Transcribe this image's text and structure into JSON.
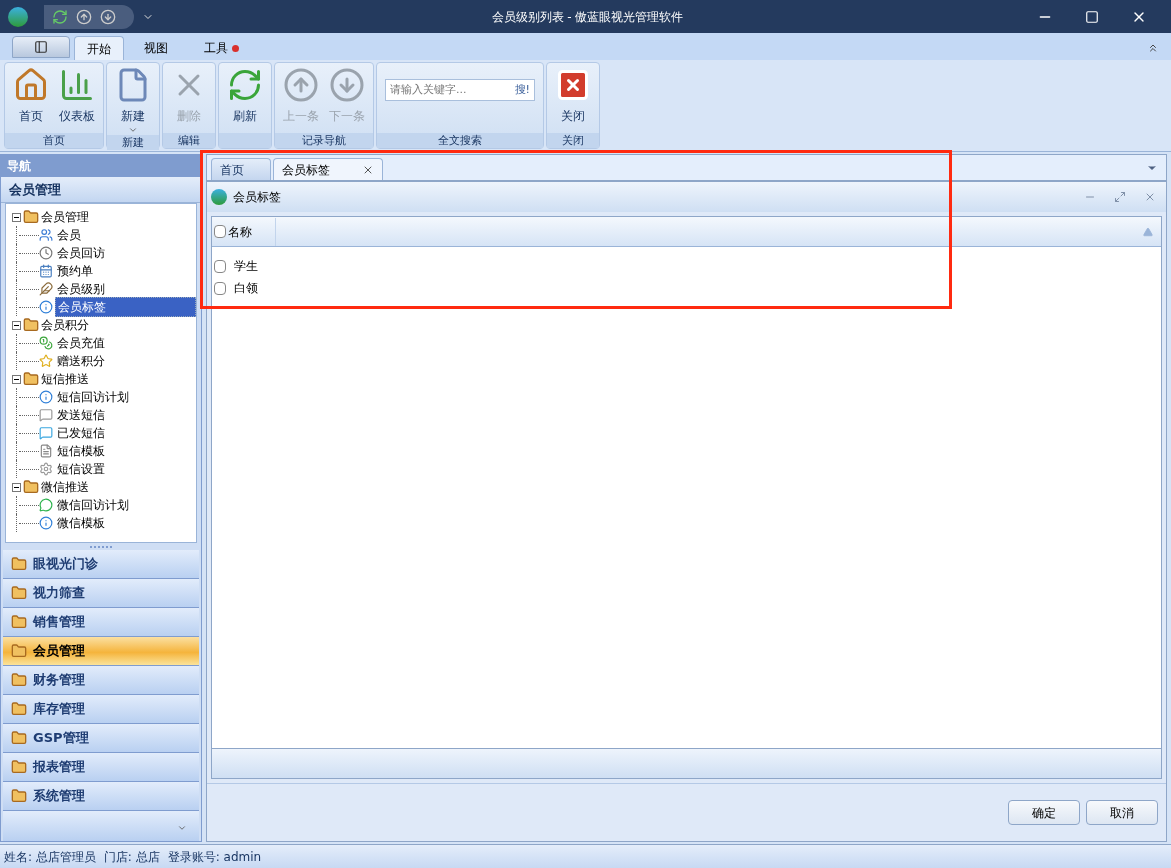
{
  "window": {
    "title": "会员级别列表 - 傲蓝眼视光管理软件"
  },
  "ribbon": {
    "tabs": [
      {
        "label": "开始",
        "selected": true,
        "badge": false
      },
      {
        "label": "视图",
        "selected": false,
        "badge": false
      },
      {
        "label": "工具",
        "selected": false,
        "badge": true
      }
    ],
    "groups": [
      {
        "label": "首页",
        "items": [
          {
            "kind": "home",
            "label": "首页",
            "disabled": false,
            "menu": false
          },
          {
            "kind": "dashboard",
            "label": "仪表板",
            "disabled": false,
            "menu": false
          }
        ]
      },
      {
        "label": "新建",
        "items": [
          {
            "kind": "new",
            "label": "新建",
            "disabled": false,
            "menu": true
          }
        ]
      },
      {
        "label": "编辑",
        "items": [
          {
            "kind": "delete",
            "label": "删除",
            "disabled": true,
            "menu": false
          }
        ]
      },
      {
        "items": [
          {
            "kind": "refresh",
            "label": "刷新",
            "disabled": false,
            "menu": false
          }
        ]
      },
      {
        "label": "记录导航",
        "items": [
          {
            "kind": "up",
            "label": "上一条",
            "disabled": true,
            "menu": false
          },
          {
            "kind": "down",
            "label": "下一条",
            "disabled": true,
            "menu": false
          }
        ]
      },
      {
        "label": "全文搜索",
        "search": {
          "placeholder": "请输入关键字...",
          "button": "搜!"
        }
      },
      {
        "label": "关闭",
        "items": [
          {
            "kind": "close",
            "label": "关闭",
            "disabled": false,
            "menu": false
          }
        ]
      }
    ]
  },
  "nav": {
    "title": "导航",
    "section": "会员管理",
    "tree": [
      {
        "label": "会员管理",
        "expanded": true,
        "children": [
          {
            "label": "会员",
            "selected": false
          },
          {
            "label": "会员回访",
            "selected": false
          },
          {
            "label": "预约单",
            "selected": false
          },
          {
            "label": "会员级别",
            "selected": false
          },
          {
            "label": "会员标签",
            "selected": true
          }
        ]
      },
      {
        "label": "会员积分",
        "expanded": true,
        "children": [
          {
            "label": "会员充值",
            "selected": false
          },
          {
            "label": "赠送积分",
            "selected": false
          }
        ]
      },
      {
        "label": "短信推送",
        "expanded": true,
        "children": [
          {
            "label": "短信回访计划",
            "selected": false
          },
          {
            "label": "发送短信",
            "selected": false
          },
          {
            "label": "已发短信",
            "selected": false
          },
          {
            "label": "短信模板",
            "selected": false
          },
          {
            "label": "短信设置",
            "selected": false
          }
        ]
      },
      {
        "label": "微信推送",
        "expanded": true,
        "children": [
          {
            "label": "微信回访计划",
            "selected": false
          },
          {
            "label": "微信模板",
            "selected": false
          }
        ]
      }
    ],
    "modules": [
      {
        "label": "眼视光门诊",
        "selected": false
      },
      {
        "label": "视力筛查",
        "selected": false
      },
      {
        "label": "销售管理",
        "selected": false
      },
      {
        "label": "会员管理",
        "selected": true
      },
      {
        "label": "财务管理",
        "selected": false
      },
      {
        "label": "库存管理",
        "selected": false
      },
      {
        "label": "GSP管理",
        "selected": false
      },
      {
        "label": "报表管理",
        "selected": false
      },
      {
        "label": "系统管理",
        "selected": false
      }
    ]
  },
  "doc_tabs": [
    {
      "label": "首页",
      "selected": false,
      "closable": false
    },
    {
      "label": "会员标签",
      "selected": true,
      "closable": true
    }
  ],
  "panel": {
    "title": "会员标签",
    "table": {
      "columns": [
        "名称"
      ],
      "header_checked": false,
      "rows": [
        {
          "name": "学生",
          "checked": false
        },
        {
          "name": "白领",
          "checked": false
        }
      ]
    }
  },
  "buttons": [
    "确定",
    "取消"
  ],
  "status_bar": [
    "姓名: 总店管理员",
    "门店: 总店",
    "登录账号: admin"
  ]
}
